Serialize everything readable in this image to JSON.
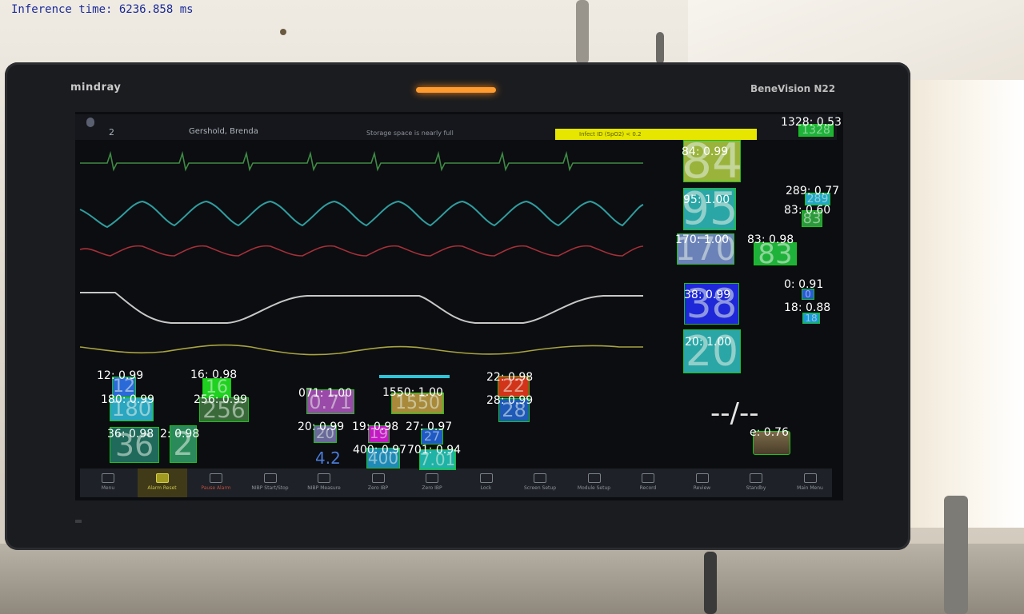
{
  "overlay": {
    "inference_label": "Inference time: 6236.858 ms"
  },
  "monitor": {
    "brand": "mindray",
    "model": "BeneVision N22",
    "status": {
      "bed": "2",
      "patient": "Gershold, Brenda",
      "message": "Storage space is nearly full",
      "alarm": "Infect ID (SpO2) < 0.2"
    },
    "nibp_display": "--/--",
    "small_value": "4.2",
    "menu": [
      {
        "label": "Menu",
        "state": "normal"
      },
      {
        "label": "Alarm Reset",
        "state": "active"
      },
      {
        "label": "Pause Alarm",
        "state": "alert"
      },
      {
        "label": "NIBP Start/Stop",
        "state": "normal"
      },
      {
        "label": "NIBP Measure",
        "state": "normal"
      },
      {
        "label": "Zero IBP",
        "state": "normal"
      },
      {
        "label": "Zero IBP",
        "state": "normal"
      },
      {
        "label": "Lock",
        "state": "normal"
      },
      {
        "label": "Screen Setup",
        "state": "normal"
      },
      {
        "label": "Module Setup",
        "state": "normal"
      },
      {
        "label": "Record",
        "state": "normal"
      },
      {
        "label": "Review",
        "state": "normal"
      },
      {
        "label": "Standby",
        "state": "normal"
      },
      {
        "label": "Main Menu",
        "state": "normal"
      }
    ]
  },
  "detections": [
    {
      "id": "d84",
      "label": "84: 0.99",
      "value": "84",
      "color": "#9ab33a"
    },
    {
      "id": "d95",
      "label": "95: 1.00",
      "value": "95",
      "color": "#2aa6a6"
    },
    {
      "id": "d170",
      "label": "170: 1.00",
      "value": "170",
      "color": "#6b82b8"
    },
    {
      "id": "d83a",
      "label": "83: 0.98",
      "value": "83",
      "color": "#1fb23a"
    },
    {
      "id": "d38",
      "label": "38: 0.99",
      "value": "38",
      "color": "#1e28d8"
    },
    {
      "id": "d20",
      "label": "20: 1.00",
      "value": "20",
      "color": "#2aa6a6"
    },
    {
      "id": "d1328",
      "label": "1328: 0.53",
      "value": "1328",
      "color": "#1fb23a"
    },
    {
      "id": "d289",
      "label": "289: 0.77",
      "value": "289",
      "color": "#21a8c4"
    },
    {
      "id": "d83b",
      "label": "83: 0.60",
      "value": "83",
      "color": "#2a9a3a"
    },
    {
      "id": "d0",
      "label": "0: 0.91",
      "value": "0",
      "color": "#2a5ad8"
    },
    {
      "id": "d18",
      "label": "18: 0.88",
      "value": "18",
      "color": "#1d9ad8"
    },
    {
      "id": "dunk",
      "label": "e: 0.76",
      "value": "",
      "color": "#6a5a3a"
    },
    {
      "id": "d12",
      "label": "12: 0.99",
      "value": "12",
      "color": "#2a6ad8"
    },
    {
      "id": "d16",
      "label": "16: 0.98",
      "value": "16",
      "color": "#1fd21f"
    },
    {
      "id": "d180",
      "label": "180: 0.99",
      "value": "180",
      "color": "#2aa6c0"
    },
    {
      "id": "d256",
      "label": "256: 0.99",
      "value": "256",
      "color": "#3a6a3a"
    },
    {
      "id": "d36",
      "label": "36: 0.98",
      "value": "36",
      "color": "#1f6a5a"
    },
    {
      "id": "d2",
      "label": "2: 0.98",
      "value": "2",
      "color": "#2a8a5a"
    },
    {
      "id": "d071",
      "label": "071: 1.00",
      "value": "0.71",
      "color": "#9a4aa8"
    },
    {
      "id": "d1550",
      "label": "1550: 1.00",
      "value": "1550",
      "color": "#a88a3a"
    },
    {
      "id": "d22",
      "label": "22: 0.98",
      "value": "22",
      "color": "#d2341a"
    },
    {
      "id": "d28",
      "label": "28: 0.99",
      "value": "28",
      "color": "#1f5ab8"
    },
    {
      "id": "d20b",
      "label": "20: 0.99",
      "value": "20",
      "color": "#6a6a9a"
    },
    {
      "id": "d19",
      "label": "19: 0.98",
      "value": "19",
      "color": "#c41ac4"
    },
    {
      "id": "d27",
      "label": "27: 0.97",
      "value": "27",
      "color": "#1f5ac4"
    },
    {
      "id": "d400",
      "label": "400: 0.97",
      "value": "400",
      "color": "#1f8ab8"
    },
    {
      "id": "d701",
      "label": "701: 0.94",
      "value": "7.01",
      "color": "#1fb2a6"
    }
  ]
}
